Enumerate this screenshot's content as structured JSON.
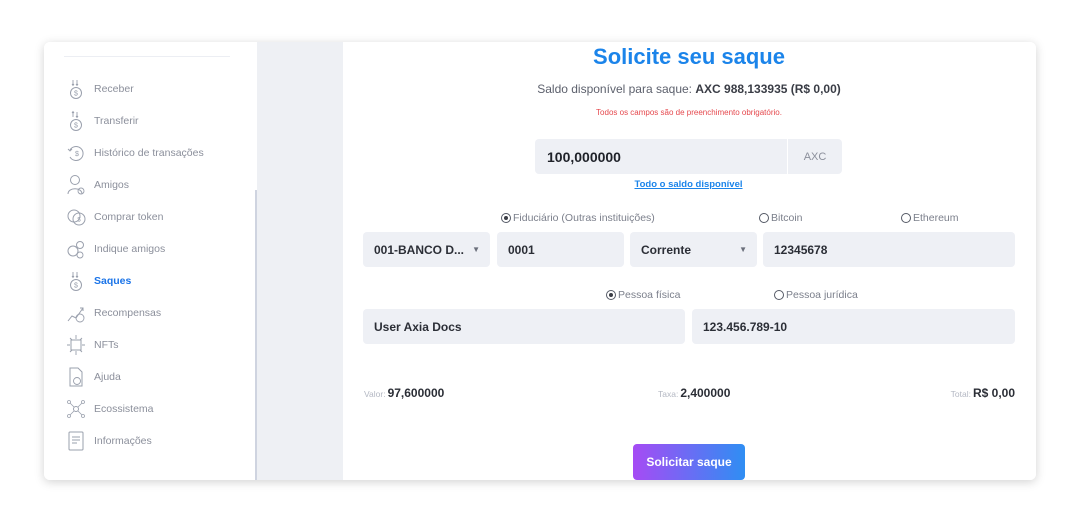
{
  "sidebar": {
    "items": [
      {
        "label": "Receber",
        "icon": "receive-coin-icon",
        "active": false
      },
      {
        "label": "Transferir",
        "icon": "transfer-coin-icon",
        "active": false
      },
      {
        "label": "Histórico de transações",
        "icon": "history-coin-icon",
        "active": false
      },
      {
        "label": "Amigos",
        "icon": "friends-icon",
        "active": false
      },
      {
        "label": "Comprar token",
        "icon": "buy-token-icon",
        "active": false
      },
      {
        "label": "Indique amigos",
        "icon": "refer-friends-icon",
        "active": false
      },
      {
        "label": "Saques",
        "icon": "withdraw-coin-icon",
        "active": true
      },
      {
        "label": "Recompensas",
        "icon": "rewards-icon",
        "active": false
      },
      {
        "label": "NFTs",
        "icon": "nft-icon",
        "active": false
      },
      {
        "label": "Ajuda",
        "icon": "help-document-icon",
        "active": false
      },
      {
        "label": "Ecossistema",
        "icon": "ecosystem-icon",
        "active": false
      },
      {
        "label": "Informações",
        "icon": "information-document-icon",
        "active": false
      }
    ]
  },
  "main": {
    "title": "Solicite seu saque",
    "balance_prefix": "Saldo disponível para saque:",
    "balance_value": "AXC 988,133935 (R$ 0,00)",
    "required_notice": "Todos os campos são de preenchimento obrigatório.",
    "amount": {
      "value": "100,000000",
      "unit": "AXC"
    },
    "all_balance_link": "Todo o saldo disponível",
    "destination_options": [
      {
        "label": "Fiduciário (Outras instituições)",
        "checked": true
      },
      {
        "label": "Bitcoin",
        "checked": false
      },
      {
        "label": "Ethereum",
        "checked": false
      }
    ],
    "bank": {
      "bank_select": "001-BANCO D...",
      "agency": "0001",
      "account_type": "Corrente",
      "account_number": "12345678"
    },
    "person_options": [
      {
        "label": "Pessoa física",
        "checked": true
      },
      {
        "label": "Pessoa jurídica",
        "checked": false
      }
    ],
    "holder_name": "User Axia Docs",
    "document": "123.456.789-10",
    "summary": {
      "valor_label": "Valor:",
      "valor": "97,600000",
      "taxa_label": "Taxa:",
      "taxa": "2,400000",
      "total_label": "Total:",
      "total": "R$ 0,00"
    },
    "submit_label": "Solicitar saque"
  },
  "colors": {
    "accent": "#1b84ea",
    "active_nav": "#1b74e8",
    "error": "#e5484d",
    "button_gradient_start": "#a64bf4",
    "button_gradient_end": "#2f8ef3"
  }
}
